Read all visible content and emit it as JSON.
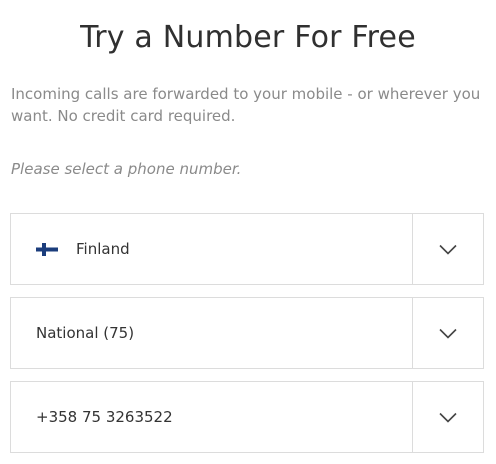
{
  "header": {
    "title": "Try a Number For Free"
  },
  "description": "Incoming calls are forwarded to your mobile - or wherever you want. No credit card required.",
  "hint": "Please select a phone number.",
  "selects": {
    "country": {
      "value": "Finland",
      "flag_icon": "finland-flag-icon",
      "chevron_icon": "chevron-down-icon"
    },
    "number_type": {
      "value": "National (75)",
      "chevron_icon": "chevron-down-icon"
    },
    "phone_number": {
      "value": "+358 75 3263522",
      "chevron_icon": "chevron-down-icon"
    }
  },
  "colors": {
    "title": "#303030",
    "muted_text": "#8a8a8a",
    "border": "#dcdcdc",
    "flag_blue": "#1b3d7c"
  }
}
